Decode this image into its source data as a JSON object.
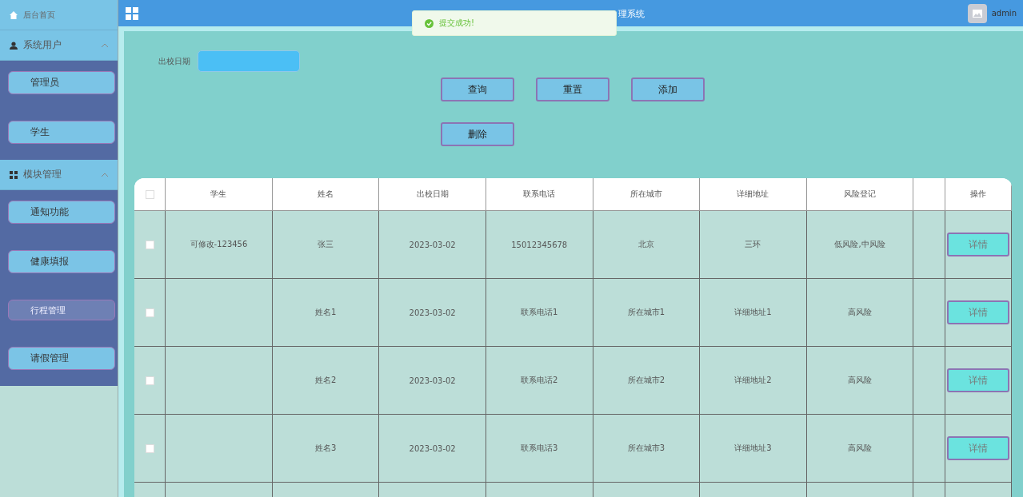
{
  "header": {
    "title": "理系统",
    "user": "admin"
  },
  "toast": {
    "kind": "success",
    "message": "提交成功!"
  },
  "sidebar": {
    "home": "后台首页",
    "groups": [
      {
        "label": "系统用户",
        "expanded": true,
        "items": [
          {
            "label": "管理员",
            "selected": false
          },
          {
            "label": "学生",
            "selected": false
          }
        ]
      },
      {
        "label": "模块管理",
        "expanded": true,
        "items": [
          {
            "label": "通知功能",
            "selected": false
          },
          {
            "label": "健康填报",
            "selected": false
          },
          {
            "label": "行程管理",
            "selected": true
          },
          {
            "label": "请假管理",
            "selected": false
          }
        ]
      }
    ]
  },
  "filter": {
    "label": "出校日期"
  },
  "buttons": [
    {
      "label": "查询"
    },
    {
      "label": "重置"
    },
    {
      "label": "添加"
    },
    {
      "label": "删除"
    }
  ],
  "table": {
    "select_all_checked": false,
    "columns": [
      "学生",
      "姓名",
      "出校日期",
      "联系电话",
      "所在城市",
      "详细地址",
      "风险登记",
      "",
      "操作"
    ],
    "rows": [
      {
        "checked": false,
        "cells": [
          "可修改-123456",
          "张三",
          "2023-03-02",
          "15012345678",
          "北京",
          "三环",
          "低风险,中风险",
          ""
        ],
        "action": "详情"
      },
      {
        "checked": false,
        "cells": [
          "",
          "姓名1",
          "2023-03-02",
          "联系电话1",
          "所在城市1",
          "详细地址1",
          "高风险",
          ""
        ],
        "action": "详情"
      },
      {
        "checked": false,
        "cells": [
          "",
          "姓名2",
          "2023-03-02",
          "联系电话2",
          "所在城市2",
          "详细地址2",
          "高风险",
          ""
        ],
        "action": "详情"
      },
      {
        "checked": false,
        "cells": [
          "",
          "姓名3",
          "2023-03-02",
          "联系电话3",
          "所在城市3",
          "详细地址3",
          "高风险",
          ""
        ],
        "action": "详情"
      }
    ]
  }
}
